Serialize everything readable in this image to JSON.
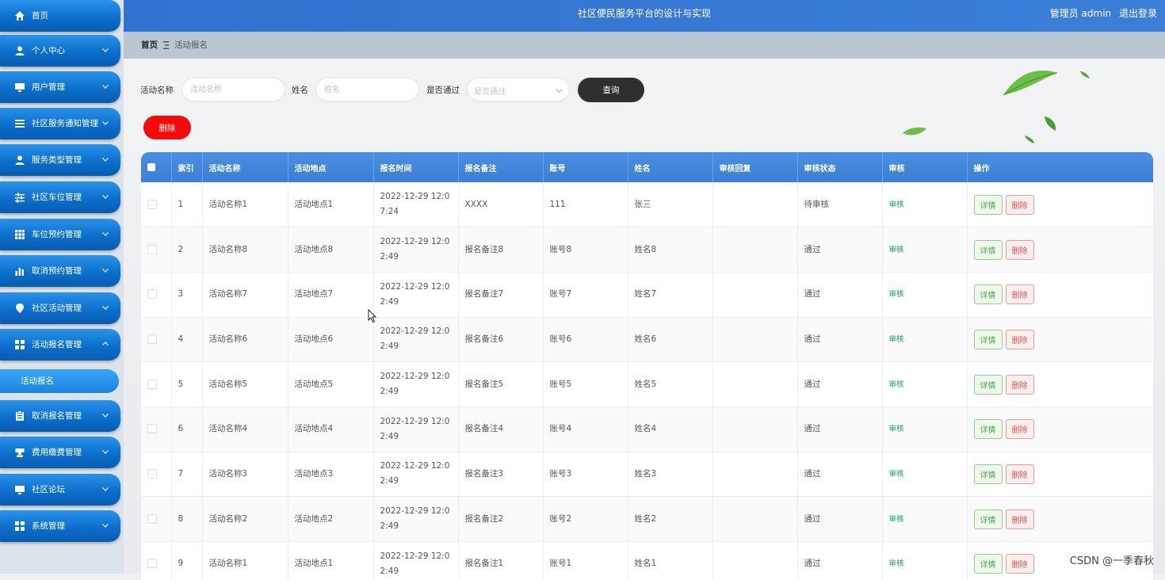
{
  "app": {
    "title": "社区便民服务平台的设计与实现",
    "user_label": "管理员 admin",
    "logout_label": "退出登录"
  },
  "sidebar": {
    "items": [
      {
        "label": "首页",
        "icon": "home-icon",
        "expandable": false
      },
      {
        "label": "个人中心",
        "icon": "user-icon",
        "expandable": true
      },
      {
        "label": "用户管理",
        "icon": "monitor-icon",
        "expandable": true
      },
      {
        "label": "社区服务通知管理",
        "icon": "list-icon",
        "expandable": true
      },
      {
        "label": "服务类型管理",
        "icon": "user-icon",
        "expandable": true
      },
      {
        "label": "社区车位管理",
        "icon": "sliders-icon",
        "expandable": true
      },
      {
        "label": "车位预约管理",
        "icon": "grid-icon",
        "expandable": true
      },
      {
        "label": "取消预约管理",
        "icon": "bar-chart-icon",
        "expandable": true
      },
      {
        "label": "社区活动管理",
        "icon": "location-pin-icon",
        "expandable": true
      },
      {
        "label": "活动报名管理",
        "icon": "apps-icon",
        "expandable": true,
        "expanded": true
      },
      {
        "label": "取消报名管理",
        "icon": "clipboard-icon",
        "expandable": true
      },
      {
        "label": "费用缴费管理",
        "icon": "cup-icon",
        "expandable": true
      },
      {
        "label": "社区论坛",
        "icon": "monitor-icon",
        "expandable": true
      },
      {
        "label": "系统管理",
        "icon": "apps-icon",
        "expandable": true
      }
    ],
    "sub_item": "活动报名"
  },
  "breadcrumb": {
    "home": "首页",
    "current": "活动报名"
  },
  "filters": {
    "activity_name_label": "活动名称",
    "activity_name_placeholder": "活动名称",
    "name_label": "姓名",
    "name_placeholder": "姓名",
    "approved_label": "是否通过",
    "approved_placeholder": "是否通过",
    "query_button": "查询",
    "delete_button": "删除"
  },
  "table": {
    "columns": [
      "索引",
      "活动名称",
      "活动地点",
      "报名时间",
      "报名备注",
      "账号",
      "姓名",
      "审核回复",
      "审核状态",
      "审核",
      "操作"
    ],
    "audit_label": "审核",
    "detail_button": "详情",
    "delete_button": "删除",
    "rows": [
      {
        "index": "1",
        "activity": "活动名称1",
        "location": "活动地点1",
        "time": "2022-12-29 12:07:24",
        "remark": "XXXX",
        "account": "111",
        "name": "张三",
        "reply": "",
        "status": "待审核"
      },
      {
        "index": "2",
        "activity": "活动名称8",
        "location": "活动地点8",
        "time": "2022-12-29 12:02:49",
        "remark": "报名备注8",
        "account": "账号8",
        "name": "姓名8",
        "reply": "",
        "status": "通过"
      },
      {
        "index": "3",
        "activity": "活动名称7",
        "location": "活动地点7",
        "time": "2022-12-29 12:02:49",
        "remark": "报名备注7",
        "account": "账号7",
        "name": "姓名7",
        "reply": "",
        "status": "通过"
      },
      {
        "index": "4",
        "activity": "活动名称6",
        "location": "活动地点6",
        "time": "2022-12-29 12:02:49",
        "remark": "报名备注6",
        "account": "账号6",
        "name": "姓名6",
        "reply": "",
        "status": "通过"
      },
      {
        "index": "5",
        "activity": "活动名称5",
        "location": "活动地点5",
        "time": "2022-12-29 12:02:49",
        "remark": "报名备注5",
        "account": "账号5",
        "name": "姓名5",
        "reply": "",
        "status": "通过"
      },
      {
        "index": "6",
        "activity": "活动名称4",
        "location": "活动地点4",
        "time": "2022-12-29 12:02:49",
        "remark": "报名备注4",
        "account": "账号4",
        "name": "姓名4",
        "reply": "",
        "status": "通过"
      },
      {
        "index": "7",
        "activity": "活动名称3",
        "location": "活动地点3",
        "time": "2022-12-29 12:02:49",
        "remark": "报名备注3",
        "account": "账号3",
        "name": "姓名3",
        "reply": "",
        "status": "通过"
      },
      {
        "index": "8",
        "activity": "活动名称2",
        "location": "活动地点2",
        "time": "2022-12-29 12:02:49",
        "remark": "报名备注2",
        "account": "账号2",
        "name": "姓名2",
        "reply": "",
        "status": "通过"
      },
      {
        "index": "9",
        "activity": "活动名称1",
        "location": "活动地点1",
        "time": "2022-12-29 12:02:49",
        "remark": "报名备注1",
        "account": "账号1",
        "name": "姓名1",
        "reply": "",
        "status": "通过"
      }
    ]
  },
  "watermark": "CSDN @一季春秋",
  "colors": {
    "header": "#3a7fd8",
    "sidebar": "#0b6fcc",
    "table_header": "#3b7fd6",
    "delete": "#f40a0a",
    "query": "#2f2f2f",
    "audit_link": "#19a05f"
  }
}
